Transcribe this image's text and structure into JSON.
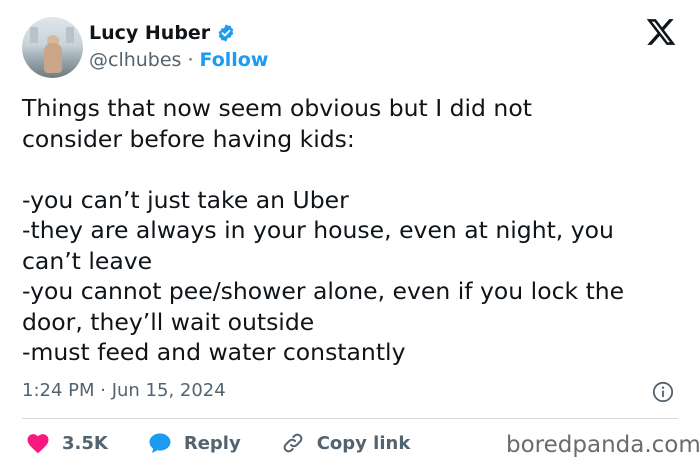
{
  "author": {
    "display_name": "Lucy Huber",
    "handle": "@clhubes",
    "separator": "·",
    "follow_label": "Follow"
  },
  "tweet": {
    "text": "Things that now seem obvious but I did not\nconsider before having kids:\n\n-you can’t just take an Uber\n-they are always in your house, even at night, you\ncan’t leave\n-you cannot pee/shower alone, even if you lock the\ndoor, they’ll wait outside\n-must feed and water constantly",
    "timestamp": "1:24 PM · Jun 15, 2024"
  },
  "actions": {
    "likes": "3.5K",
    "reply_label": "Reply",
    "copy_link_label": "Copy link"
  },
  "watermark": "boredpanda.com",
  "colors": {
    "accent": "#1d9bf0",
    "like": "#f91880",
    "text": "#0f1419",
    "secondary": "#536471"
  },
  "icons": {
    "verified": "verified-badge-icon",
    "brand": "x-logo-icon",
    "info": "info-icon",
    "like": "heart-icon",
    "reply": "speech-bubble-icon",
    "copy": "link-icon"
  }
}
